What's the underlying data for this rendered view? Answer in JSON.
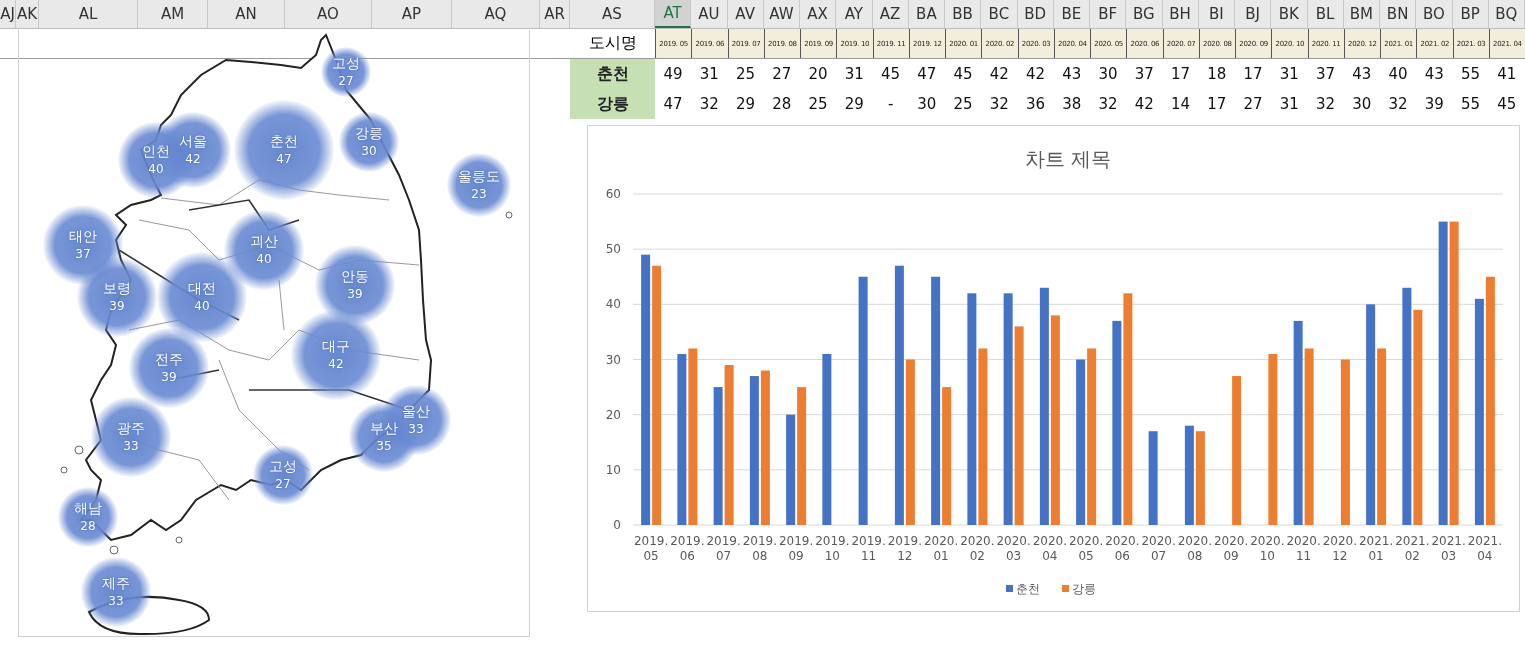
{
  "column_headers": [
    {
      "label": "AJ",
      "selected": false
    },
    {
      "label": "AK",
      "selected": false
    },
    {
      "label": "AL",
      "selected": false
    },
    {
      "label": "AM",
      "selected": false
    },
    {
      "label": "AN",
      "selected": false
    },
    {
      "label": "AO",
      "selected": false
    },
    {
      "label": "AP",
      "selected": false
    },
    {
      "label": "AQ",
      "selected": false
    },
    {
      "label": "AR",
      "selected": false
    },
    {
      "label": "AS",
      "selected": false
    },
    {
      "label": "AT",
      "selected": true
    },
    {
      "label": "AU",
      "selected": false
    },
    {
      "label": "AV",
      "selected": false
    },
    {
      "label": "AW",
      "selected": false
    },
    {
      "label": "AX",
      "selected": false
    },
    {
      "label": "AY",
      "selected": false
    },
    {
      "label": "AZ",
      "selected": false
    },
    {
      "label": "BA",
      "selected": false
    },
    {
      "label": "BB",
      "selected": false
    },
    {
      "label": "BC",
      "selected": false
    },
    {
      "label": "BD",
      "selected": false
    },
    {
      "label": "BE",
      "selected": false
    },
    {
      "label": "BF",
      "selected": false
    },
    {
      "label": "BG",
      "selected": false
    },
    {
      "label": "BH",
      "selected": false
    },
    {
      "label": "BI",
      "selected": false
    },
    {
      "label": "BJ",
      "selected": false
    },
    {
      "label": "BK",
      "selected": false
    },
    {
      "label": "BL",
      "selected": false
    },
    {
      "label": "BM",
      "selected": false
    },
    {
      "label": "BN",
      "selected": false
    },
    {
      "label": "BO",
      "selected": false
    },
    {
      "label": "BP",
      "selected": false
    },
    {
      "label": "BQ",
      "selected": false
    }
  ],
  "table": {
    "header_label": "도시명",
    "dates": [
      "2019. 05",
      "2019. 06",
      "2019. 07",
      "2019. 08",
      "2019. 09",
      "2019. 10",
      "2019. 11",
      "2019. 12",
      "2020. 01",
      "2020. 02",
      "2020. 03",
      "2020. 04",
      "2020. 05",
      "2020. 06",
      "2020. 07",
      "2020. 08",
      "2020. 09",
      "2020. 10",
      "2020. 11",
      "2020. 12",
      "2021. 01",
      "2021. 02",
      "2021. 03",
      "2021. 04"
    ],
    "rows": [
      {
        "city": "춘천",
        "cells": [
          "49",
          "31",
          "25",
          "27",
          "20",
          "31",
          "45",
          "47",
          "45",
          "42",
          "42",
          "43",
          "30",
          "37",
          "17",
          "18",
          "17",
          "31",
          "37",
          "43",
          "40",
          "43",
          "55",
          "41"
        ]
      },
      {
        "city": "강릉",
        "cells": [
          "47",
          "32",
          "29",
          "28",
          "25",
          "29",
          "-",
          "30",
          "25",
          "32",
          "36",
          "38",
          "32",
          "42",
          "14",
          "17",
          "27",
          "31",
          "32",
          "30",
          "32",
          "39",
          "55",
          "45"
        ]
      }
    ]
  },
  "map": {
    "bubbles": [
      {
        "name": "고성",
        "value": "27"
      },
      {
        "name": "인천",
        "value": "40"
      },
      {
        "name": "서울",
        "value": "42"
      },
      {
        "name": "춘천",
        "value": "47"
      },
      {
        "name": "강릉",
        "value": "30"
      },
      {
        "name": "울릉도",
        "value": "23"
      },
      {
        "name": "태안",
        "value": "37"
      },
      {
        "name": "괴산",
        "value": "40"
      },
      {
        "name": "안동",
        "value": "39"
      },
      {
        "name": "보령",
        "value": "39"
      },
      {
        "name": "대전",
        "value": "40"
      },
      {
        "name": "대구",
        "value": "42"
      },
      {
        "name": "전주",
        "value": "39"
      },
      {
        "name": "울산",
        "value": "33"
      },
      {
        "name": "광주",
        "value": "33"
      },
      {
        "name": "부산",
        "value": "35"
      },
      {
        "name": "고성",
        "value": "27"
      },
      {
        "name": "해남",
        "value": "28"
      },
      {
        "name": "제주",
        "value": "33"
      }
    ]
  },
  "chart": {
    "chart_data": {
      "type": "bar",
      "title": "차트 제목",
      "categories": [
        "2019. 05",
        "2019. 06",
        "2019. 07",
        "2019. 08",
        "2019. 09",
        "2019. 10",
        "2019. 11",
        "2019. 12",
        "2020. 01",
        "2020. 02",
        "2020. 03",
        "2020. 04",
        "2020. 05",
        "2020. 06",
        "2020. 07",
        "2020. 08",
        "2020. 09",
        "2020. 10",
        "2020. 11",
        "2020. 12",
        "2021. 01",
        "2021. 02",
        "2021. 03",
        "2021. 04"
      ],
      "grid": true,
      "legend": true,
      "ylim": [
        0,
        60
      ],
      "yticks": [
        0,
        10,
        20,
        30,
        40,
        50,
        60
      ],
      "series": [
        {
          "name": "춘천",
          "color": "#4472c4",
          "values": [
            49,
            31,
            25,
            27,
            20,
            31,
            45,
            47,
            45,
            42,
            42,
            43,
            30,
            37,
            17,
            18,
            null,
            null,
            37,
            null,
            40,
            43,
            55,
            41
          ]
        },
        {
          "name": "강릉",
          "color": "#ed7d31",
          "values": [
            47,
            32,
            29,
            28,
            25,
            null,
            null,
            30,
            25,
            32,
            36,
            38,
            32,
            42,
            null,
            17,
            27,
            31,
            32,
            30,
            32,
            39,
            55,
            45
          ]
        }
      ]
    }
  }
}
